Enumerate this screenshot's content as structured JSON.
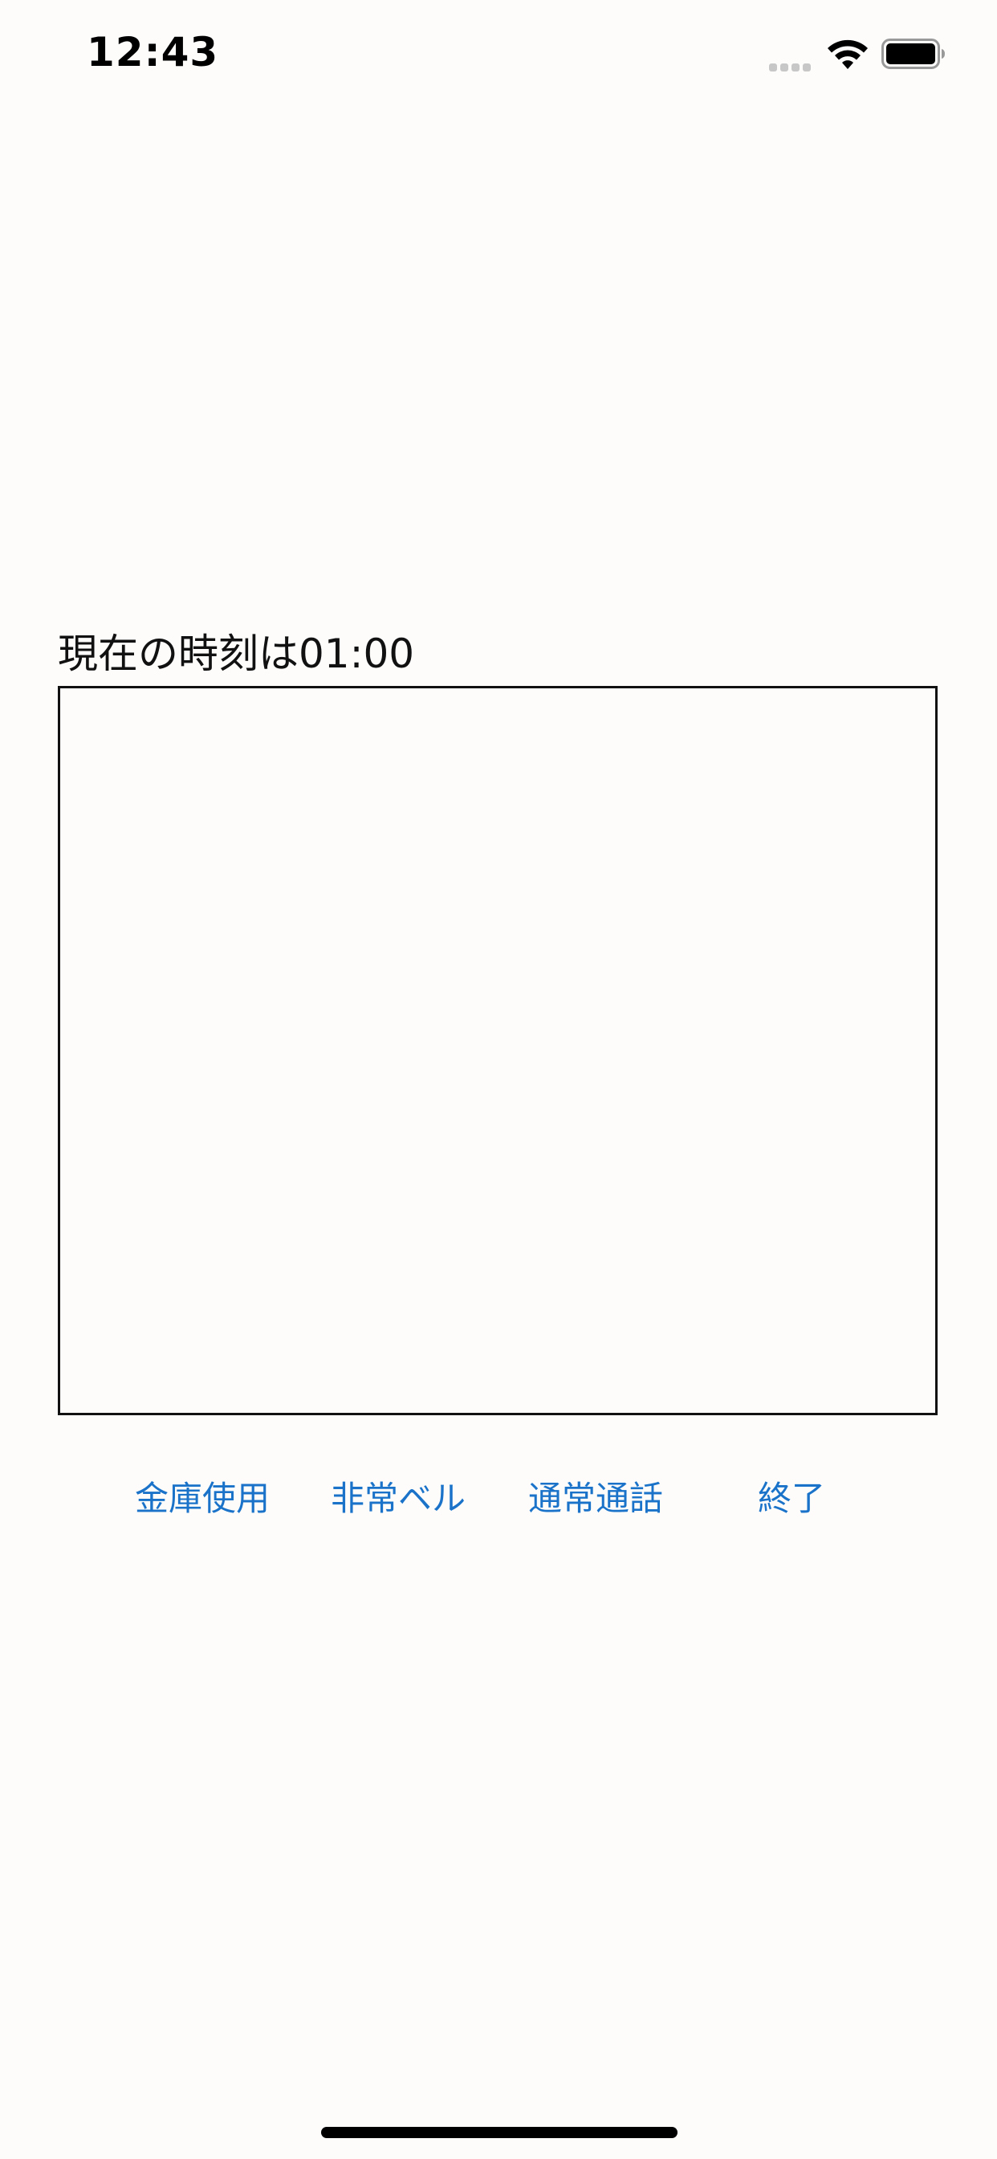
{
  "status_bar": {
    "time": "12:43",
    "icons": [
      "cellular-signal-icon",
      "wifi-icon",
      "battery-icon"
    ]
  },
  "main": {
    "current_time_label": "現在の時刻は01:00",
    "text_area_value": ""
  },
  "actions": {
    "safe_label": "金庫使用",
    "alarm_label": "非常ベル",
    "call_label": "通常通話",
    "end_label": "終了"
  },
  "colors": {
    "background": "#fdfcfb",
    "accent": "#1a73c9",
    "text": "#111111"
  }
}
